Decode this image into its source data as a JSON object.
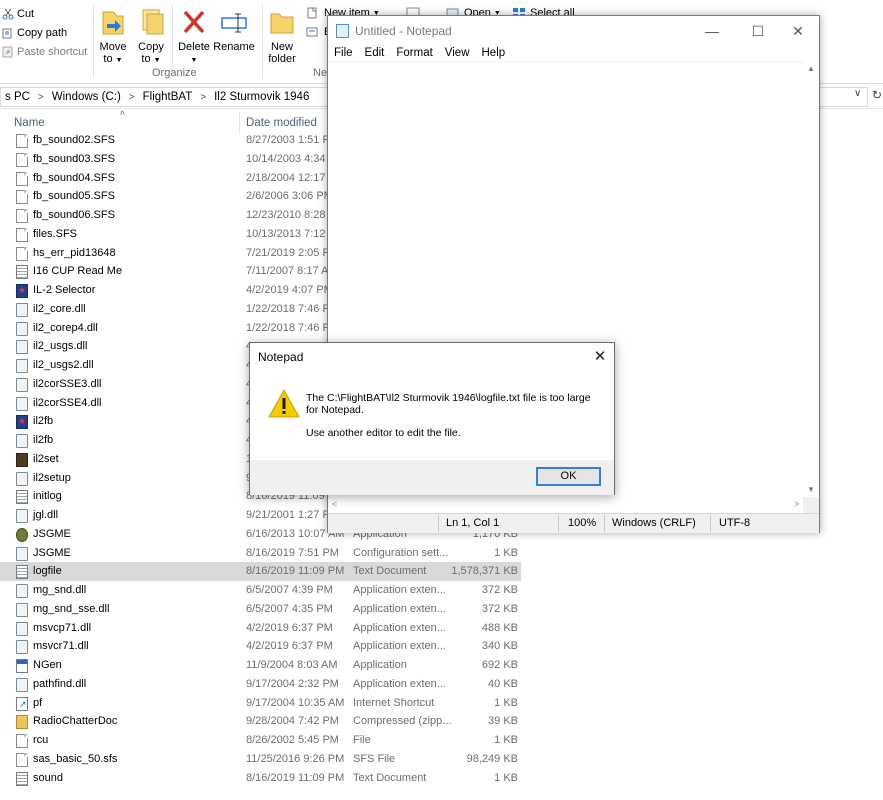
{
  "ribbon": {
    "clipboard": {
      "cut": "Cut",
      "copy_path": "Copy path",
      "paste_shortcut": "Paste shortcut"
    },
    "organize": {
      "move_to": "Move",
      "move_to_2": "to",
      "copy_to": "Copy",
      "copy_to_2": "to",
      "delete": "Delete",
      "rename": "Rename",
      "group_label": "Organize"
    },
    "new": {
      "new_folder": "New",
      "new_folder_2": "folder",
      "new_item": "New item",
      "easy_access": "E",
      "group_label": "Ne"
    },
    "open": {
      "open": "Open"
    },
    "select": {
      "select_all": "Select all"
    }
  },
  "address": {
    "crumbs": [
      "s PC",
      "Windows (C:)",
      "FlightBAT",
      "Il2 Sturmovik 1946"
    ]
  },
  "columns": {
    "name": "Name",
    "date_modified": "Date modified"
  },
  "files": [
    {
      "name": "fb_sound02.SFS",
      "date": "8/27/2003 1:51 PM",
      "type": "",
      "size": "",
      "icon": "document-icon"
    },
    {
      "name": "fb_sound03.SFS",
      "date": "10/14/2003 4:34 PM",
      "type": "",
      "size": "",
      "icon": "document-icon"
    },
    {
      "name": "fb_sound04.SFS",
      "date": "2/18/2004 12:17 PM",
      "type": "",
      "size": "",
      "icon": "document-icon"
    },
    {
      "name": "fb_sound05.SFS",
      "date": "2/6/2006 3:06 PM",
      "type": "",
      "size": "",
      "icon": "document-icon"
    },
    {
      "name": "fb_sound06.SFS",
      "date": "12/23/2010 8:28 AM",
      "type": "",
      "size": "",
      "icon": "document-icon"
    },
    {
      "name": "files.SFS",
      "date": "10/13/2013 7:12 PM",
      "type": "",
      "size": "",
      "icon": "document-icon"
    },
    {
      "name": "hs_err_pid13648",
      "date": "7/21/2019 2:05 PM",
      "type": "",
      "size": "",
      "icon": "document-icon"
    },
    {
      "name": "I16 CUP Read Me",
      "date": "7/11/2007 8:17 AM",
      "type": "",
      "size": "",
      "icon": "text-document-icon"
    },
    {
      "name": "IL-2 Selector",
      "date": "4/2/2019 4:07 PM",
      "type": "",
      "size": "",
      "icon": "app-icon"
    },
    {
      "name": "il2_core.dll",
      "date": "1/22/2018 7:46 PM",
      "type": "",
      "size": "",
      "icon": "dll-gear-icon"
    },
    {
      "name": "il2_corep4.dll",
      "date": "1/22/2018 7:46 PM",
      "type": "",
      "size": "",
      "icon": "dll-gear-icon"
    },
    {
      "name": "il2_usgs.dll",
      "date": "4",
      "type": "",
      "size": "",
      "icon": "dll-gear-icon"
    },
    {
      "name": "il2_usgs2.dll",
      "date": "4",
      "type": "",
      "size": "",
      "icon": "dll-gear-icon"
    },
    {
      "name": "il2corSSE3.dll",
      "date": "4",
      "type": "",
      "size": "",
      "icon": "dll-gear-icon"
    },
    {
      "name": "il2corSSE4.dll",
      "date": "4",
      "type": "",
      "size": "",
      "icon": "dll-gear-icon"
    },
    {
      "name": "il2fb",
      "date": "4",
      "type": "",
      "size": "",
      "icon": "app-icon"
    },
    {
      "name": "il2fb",
      "date": "4",
      "type": "",
      "size": "",
      "icon": "dll-gear-icon"
    },
    {
      "name": "il2set",
      "date": "1",
      "type": "",
      "size": "",
      "icon": "il2set-icon"
    },
    {
      "name": "il2setup",
      "date": "9",
      "type": "",
      "size": "",
      "icon": "dll-gear-icon"
    },
    {
      "name": "initlog",
      "date": "8/16/2019 11:09 P",
      "type": "",
      "size": "",
      "icon": "text-document-icon"
    },
    {
      "name": "jgl.dll",
      "date": "9/21/2001 1:27 PM",
      "type": "",
      "size": "",
      "icon": "dll-gear-icon"
    },
    {
      "name": "JSGME",
      "date": "6/16/2013 10:07 AM",
      "type": "Application",
      "size": "1,170 KB",
      "icon": "jsgme-icon"
    },
    {
      "name": "JSGME",
      "date": "8/16/2019 7:51 PM",
      "type": "Configuration sett...",
      "size": "1 KB",
      "icon": "dll-gear-icon"
    },
    {
      "name": "logfile",
      "date": "8/16/2019 11:09 PM",
      "type": "Text Document",
      "size": "1,578,371 KB",
      "icon": "text-document-icon",
      "selected": true
    },
    {
      "name": "mg_snd.dll",
      "date": "6/5/2007 4:39 PM",
      "type": "Application exten...",
      "size": "372 KB",
      "icon": "dll-gear-icon"
    },
    {
      "name": "mg_snd_sse.dll",
      "date": "6/5/2007 4:35 PM",
      "type": "Application exten...",
      "size": "372 KB",
      "icon": "dll-gear-icon"
    },
    {
      "name": "msvcp71.dll",
      "date": "4/2/2019 6:37 PM",
      "type": "Application exten...",
      "size": "488 KB",
      "icon": "dll-gear-icon"
    },
    {
      "name": "msvcr71.dll",
      "date": "4/2/2019 6:37 PM",
      "type": "Application exten...",
      "size": "340 KB",
      "icon": "dll-gear-icon"
    },
    {
      "name": "NGen",
      "date": "11/9/2004 8:03 AM",
      "type": "Application",
      "size": "692 KB",
      "icon": "exe-window-icon"
    },
    {
      "name": "pathfind.dll",
      "date": "9/17/2004 2:32 PM",
      "type": "Application exten...",
      "size": "40 KB",
      "icon": "dll-gear-icon"
    },
    {
      "name": "pf",
      "date": "9/17/2004 10:35 AM",
      "type": "Internet Shortcut",
      "size": "1 KB",
      "icon": "shortcut-icon"
    },
    {
      "name": "RadioChatterDoc",
      "date": "9/28/2004 7:42 PM",
      "type": "Compressed (zipp...",
      "size": "39 KB",
      "icon": "zip-folder-icon"
    },
    {
      "name": "rcu",
      "date": "8/26/2002 5:45 PM",
      "type": "File",
      "size": "1 KB",
      "icon": "document-icon"
    },
    {
      "name": "sas_basic_50.sfs",
      "date": "11/25/2016 9:26 PM",
      "type": "SFS File",
      "size": "98,249 KB",
      "icon": "document-icon"
    },
    {
      "name": "sound",
      "date": "8/16/2019 11:09 PM",
      "type": "Text Document",
      "size": "1 KB",
      "icon": "text-document-icon"
    }
  ],
  "notepad": {
    "title": "Untitled - Notepad",
    "menu": [
      "File",
      "Edit",
      "Format",
      "View",
      "Help"
    ],
    "status": {
      "position": "Ln 1, Col 1",
      "zoom": "100%",
      "line_endings": "Windows (CRLF)",
      "encoding": "UTF-8"
    }
  },
  "dialog": {
    "title": "Notepad",
    "message": "The C:\\FlightBAT\\Il2 Sturmovik 1946\\logfile.txt file is too large for Notepad.",
    "hint": "Use another editor to edit the file.",
    "ok": "OK"
  },
  "colors": {
    "accent": "#3b80d0",
    "selected_row": "#d9d9d9",
    "delete_red": "#d0332b",
    "warning_yellow": "#f5c900"
  }
}
